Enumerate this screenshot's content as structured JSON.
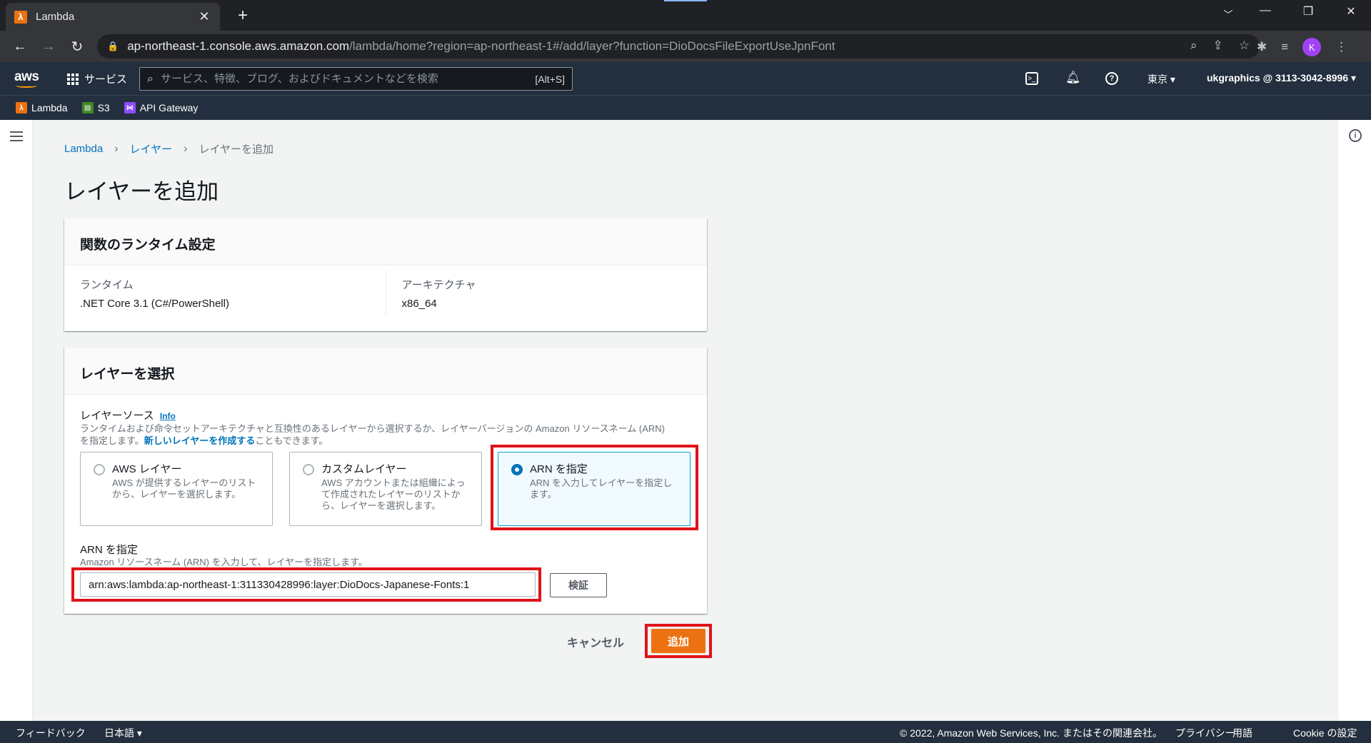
{
  "browser": {
    "tab_title": "Lambda",
    "tab_favicon": "λ",
    "url_host": "ap-northeast-1.console.aws.amazon.com",
    "url_path": "/lambda/home?region=ap-northeast-1#/add/layer?function=DioDocsFileExportUseJpnFont",
    "profile_initial": "K"
  },
  "aws_nav": {
    "logo": "aws",
    "services_label": "サービス",
    "search_placeholder": "サービス、特徴、ブログ、およびドキュメントなどを検索",
    "search_shortcut": "[Alt+S]",
    "region": "東京 ▾",
    "account": "ukgraphics @ 3113-3042-8996 ▾"
  },
  "favorites": [
    {
      "label": "Lambda",
      "icon": "lambda-icon",
      "color": "#ec7211"
    },
    {
      "label": "S3",
      "icon": "s3-icon",
      "color": "#3f8624"
    },
    {
      "label": "API Gateway",
      "icon": "api-gateway-icon",
      "color": "#8c4fff"
    }
  ],
  "breadcrumb": {
    "items": [
      "Lambda",
      "レイヤー"
    ],
    "current": "レイヤーを追加"
  },
  "page": {
    "title": "レイヤーを追加"
  },
  "runtime_panel": {
    "title": "関数のランタイム設定",
    "runtime_label": "ランタイム",
    "runtime_value": ".NET Core 3.1 (C#/PowerShell)",
    "arch_label": "アーキテクチャ",
    "arch_value": "x86_64"
  },
  "layer_panel": {
    "title": "レイヤーを選択",
    "source_label": "レイヤーソース",
    "info_link": "Info",
    "source_desc_line1": "ランタイムおよび命令セットアーキテクチャと互換性のあるレイヤーから選択するか、レイヤーバージョンの Amazon リソースネーム (ARN)",
    "source_desc_prefix": "を指定します。",
    "source_desc_link": "新しいレイヤーを作成する",
    "source_desc_suffix": "こともできます。",
    "options": [
      {
        "title": "AWS レイヤー",
        "desc": "AWS が提供するレイヤーのリストから、レイヤーを選択します。",
        "selected": false
      },
      {
        "title": "カスタムレイヤー",
        "desc": "AWS アカウントまたは組織によって作成されたレイヤーのリストから、レイヤーを選択します。",
        "selected": false
      },
      {
        "title": "ARN を指定",
        "desc": "ARN を入力してレイヤーを指定します。",
        "selected": true
      }
    ],
    "arn_label": "ARN を指定",
    "arn_desc": "Amazon リソースネーム (ARN) を入力して、レイヤーを指定します。",
    "arn_value": "arn:aws:lambda:ap-northeast-1:311330428996:layer:DioDocs-Japanese-Fonts:1",
    "verify_label": "検証"
  },
  "actions": {
    "cancel_label": "キャンセル",
    "add_label": "追加"
  },
  "footer": {
    "feedback": "フィードバック",
    "language": "日本語 ▾",
    "copyright": "© 2022, Amazon Web Services, Inc. またはその関連会社。",
    "privacy": "プライバシー",
    "terms": "用語",
    "cookie": "Cookie の設定"
  },
  "colors": {
    "aws_nav": "#232f3e",
    "primary_button": "#ec7211",
    "link": "#0073bb",
    "annotation": "#e0131a"
  }
}
